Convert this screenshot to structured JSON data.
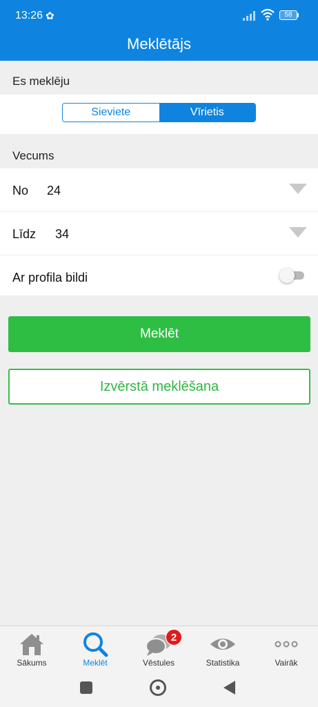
{
  "status": {
    "time": "13:26",
    "battery": "58"
  },
  "header": {
    "title": "Meklētājs"
  },
  "gender": {
    "label": "Es meklēju",
    "options": [
      "Sieviete",
      "Vīrietis"
    ],
    "selected": "Vīrietis"
  },
  "age": {
    "label": "Vecums",
    "from_label": "No",
    "from_value": "24",
    "to_label": "Līdz",
    "to_value": "34"
  },
  "photo_filter": {
    "label": "Ar profila bildi",
    "enabled": false
  },
  "actions": {
    "search": "Meklēt",
    "advanced": "Izvērstā meklēšana"
  },
  "tabs": [
    {
      "label": "Sākums",
      "icon": "home-icon"
    },
    {
      "label": "Meklēt",
      "icon": "search-icon",
      "active": true
    },
    {
      "label": "Vēstules",
      "icon": "chat-icon",
      "badge": "2"
    },
    {
      "label": "Statistika",
      "icon": "eye-icon"
    },
    {
      "label": "Vairāk",
      "icon": "more-icon"
    }
  ],
  "colors": {
    "primary": "#0e84e0",
    "accent": "#2fbe44",
    "badge": "#e11b1b"
  }
}
